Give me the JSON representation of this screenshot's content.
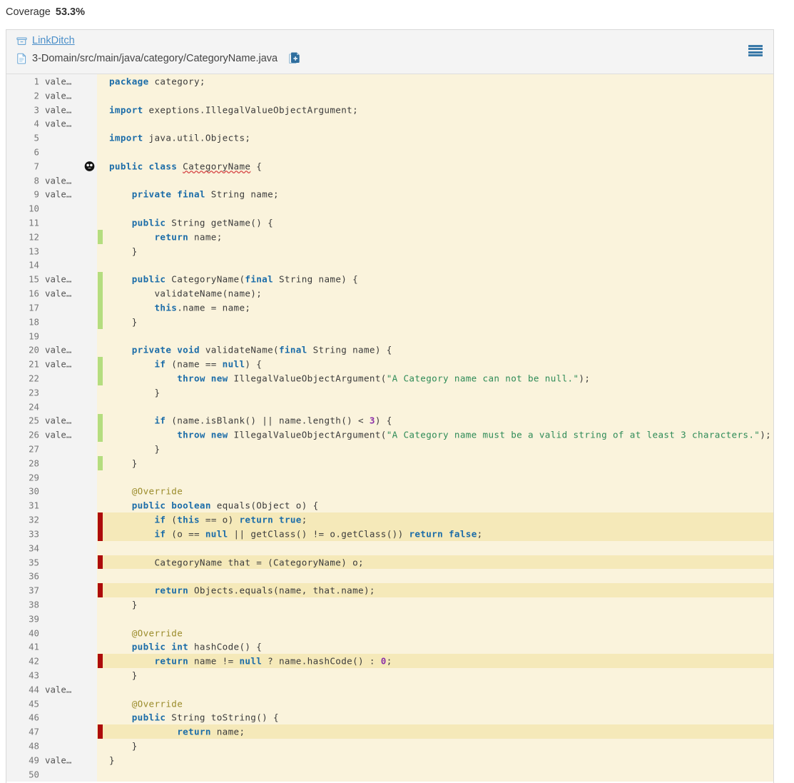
{
  "coverage": {
    "label": "Coverage",
    "value": "53.3%"
  },
  "breadcrumb": {
    "project_icon": "box-icon",
    "project": "LinkDitch",
    "file_icon": "file-icon",
    "file_path": "3-Domain/src/main/java/category/CategoryName.java",
    "copy_icon": "copy-file-icon"
  },
  "menu": {
    "icon": "hamburger-menu-icon"
  },
  "colors": {
    "covered": "#b4dd7f",
    "uncovered": "#ad0b0b",
    "code_bg": "#faf3dc",
    "highlight_bg": "#f5e9b9",
    "gutter_bg": "#f3f3f3",
    "link": "#4b8fc9",
    "keyword": "#1b6ca8",
    "string": "#2e8b57",
    "number": "#8b2fa8",
    "annotation": "#9a8b2a"
  },
  "author_label": "vale…",
  "lines": [
    {
      "n": "1",
      "author": "vale…",
      "cov": "",
      "hl": false,
      "html": "<span class=\"k\">package</span> category;"
    },
    {
      "n": "2",
      "author": "vale…",
      "cov": "",
      "hl": false,
      "html": ""
    },
    {
      "n": "3",
      "author": "vale…",
      "cov": "",
      "hl": false,
      "html": "<span class=\"k\">import</span> exeptions.IllegalValueObjectArgument;"
    },
    {
      "n": "4",
      "author": "vale…",
      "cov": "",
      "hl": false,
      "html": ""
    },
    {
      "n": "5",
      "author": "",
      "cov": "",
      "hl": false,
      "html": "<span class=\"k\">import</span> java.util.Objects;"
    },
    {
      "n": "6",
      "author": "",
      "cov": "",
      "hl": false,
      "html": ""
    },
    {
      "n": "7",
      "author": "",
      "cov": "",
      "hl": false,
      "mutation": true,
      "html": "<span class=\"k\">public</span> <span class=\"k\">class</span> <span class=\"sq\">CategoryName</span> {"
    },
    {
      "n": "8",
      "author": "vale…",
      "cov": "",
      "hl": false,
      "html": ""
    },
    {
      "n": "9",
      "author": "vale…",
      "cov": "",
      "hl": false,
      "html": "    <span class=\"k\">private</span> <span class=\"k\">final</span> String name;"
    },
    {
      "n": "10",
      "author": "",
      "cov": "",
      "hl": false,
      "html": ""
    },
    {
      "n": "11",
      "author": "",
      "cov": "",
      "hl": false,
      "html": "    <span class=\"k\">public</span> String getName() {"
    },
    {
      "n": "12",
      "author": "",
      "cov": "g",
      "hl": false,
      "html": "        <span class=\"k\">return</span> name;"
    },
    {
      "n": "13",
      "author": "",
      "cov": "",
      "hl": false,
      "html": "    }"
    },
    {
      "n": "14",
      "author": "",
      "cov": "",
      "hl": false,
      "html": ""
    },
    {
      "n": "15",
      "author": "vale…",
      "cov": "g",
      "hl": false,
      "html": "    <span class=\"k\">public</span> CategoryName(<span class=\"k\">final</span> String name) {"
    },
    {
      "n": "16",
      "author": "vale…",
      "cov": "g",
      "hl": false,
      "html": "        validateName(name);"
    },
    {
      "n": "17",
      "author": "",
      "cov": "g",
      "hl": false,
      "html": "        <span class=\"k\">this</span>.name = name;"
    },
    {
      "n": "18",
      "author": "",
      "cov": "g",
      "hl": false,
      "html": "    }"
    },
    {
      "n": "19",
      "author": "",
      "cov": "",
      "hl": false,
      "html": ""
    },
    {
      "n": "20",
      "author": "vale…",
      "cov": "",
      "hl": false,
      "html": "    <span class=\"k\">private</span> <span class=\"k\">void</span> validateName(<span class=\"k\">final</span> String name) {"
    },
    {
      "n": "21",
      "author": "vale…",
      "cov": "g",
      "hl": false,
      "html": "        <span class=\"k\">if</span> (name == <span class=\"k\">null</span>) {"
    },
    {
      "n": "22",
      "author": "",
      "cov": "g",
      "hl": false,
      "html": "            <span class=\"k\">throw</span> <span class=\"k\">new</span> IllegalValueObjectArgument(<span class=\"s\">\"A Category name can not be null.\"</span>);"
    },
    {
      "n": "23",
      "author": "",
      "cov": "",
      "hl": false,
      "html": "        }"
    },
    {
      "n": "24",
      "author": "",
      "cov": "",
      "hl": false,
      "html": ""
    },
    {
      "n": "25",
      "author": "vale…",
      "cov": "g",
      "hl": false,
      "html": "        <span class=\"k\">if</span> (name.isBlank() || name.length() &lt; <span class=\"n\">3</span>) {"
    },
    {
      "n": "26",
      "author": "vale…",
      "cov": "g",
      "hl": false,
      "html": "            <span class=\"k\">throw</span> <span class=\"k\">new</span> IllegalValueObjectArgument(<span class=\"s\">\"A Category name must be a valid string of at least 3 characters.\"</span>);"
    },
    {
      "n": "27",
      "author": "",
      "cov": "",
      "hl": false,
      "html": "        }"
    },
    {
      "n": "28",
      "author": "",
      "cov": "g",
      "hl": false,
      "html": "    }"
    },
    {
      "n": "29",
      "author": "",
      "cov": "",
      "hl": false,
      "html": ""
    },
    {
      "n": "30",
      "author": "",
      "cov": "",
      "hl": false,
      "html": "    <span class=\"a\">@Override</span>"
    },
    {
      "n": "31",
      "author": "",
      "cov": "",
      "hl": false,
      "html": "    <span class=\"k\">public</span> <span class=\"k\">boolean</span> equals(Object o) {"
    },
    {
      "n": "32",
      "author": "",
      "cov": "r",
      "hl": true,
      "html": "        <span class=\"k\">if</span> (<span class=\"k\">this</span> == o) <span class=\"k\">return</span> <span class=\"k\">true</span>;"
    },
    {
      "n": "33",
      "author": "",
      "cov": "r",
      "hl": true,
      "html": "        <span class=\"k\">if</span> (o == <span class=\"k\">null</span> || getClass() != o.getClass()) <span class=\"k\">return</span> <span class=\"k\">false</span>;"
    },
    {
      "n": "34",
      "author": "",
      "cov": "",
      "hl": false,
      "html": ""
    },
    {
      "n": "35",
      "author": "",
      "cov": "r",
      "hl": true,
      "html": "        CategoryName that = (CategoryName) o;"
    },
    {
      "n": "36",
      "author": "",
      "cov": "",
      "hl": false,
      "html": ""
    },
    {
      "n": "37",
      "author": "",
      "cov": "r",
      "hl": true,
      "html": "        <span class=\"k\">return</span> Objects.equals(name, that.name);"
    },
    {
      "n": "38",
      "author": "",
      "cov": "",
      "hl": false,
      "html": "    }"
    },
    {
      "n": "39",
      "author": "",
      "cov": "",
      "hl": false,
      "html": ""
    },
    {
      "n": "40",
      "author": "",
      "cov": "",
      "hl": false,
      "html": "    <span class=\"a\">@Override</span>"
    },
    {
      "n": "41",
      "author": "",
      "cov": "",
      "hl": false,
      "html": "    <span class=\"k\">public</span> <span class=\"k\">int</span> hashCode() {"
    },
    {
      "n": "42",
      "author": "",
      "cov": "r",
      "hl": true,
      "html": "        <span class=\"k\">return</span> name != <span class=\"k\">null</span> ? name.hashCode() : <span class=\"n\">0</span>;"
    },
    {
      "n": "43",
      "author": "",
      "cov": "",
      "hl": false,
      "html": "    }"
    },
    {
      "n": "44",
      "author": "vale…",
      "cov": "",
      "hl": false,
      "html": ""
    },
    {
      "n": "45",
      "author": "",
      "cov": "",
      "hl": false,
      "html": "    <span class=\"a\">@Override</span>"
    },
    {
      "n": "46",
      "author": "",
      "cov": "",
      "hl": false,
      "html": "    <span class=\"k\">public</span> String toString() {"
    },
    {
      "n": "47",
      "author": "",
      "cov": "r",
      "hl": true,
      "html": "            <span class=\"k\">return</span> name;"
    },
    {
      "n": "48",
      "author": "",
      "cov": "",
      "hl": false,
      "html": "    }"
    },
    {
      "n": "49",
      "author": "vale…",
      "cov": "",
      "hl": false,
      "html": "}"
    },
    {
      "n": "50",
      "author": "",
      "cov": "",
      "hl": false,
      "html": ""
    }
  ]
}
